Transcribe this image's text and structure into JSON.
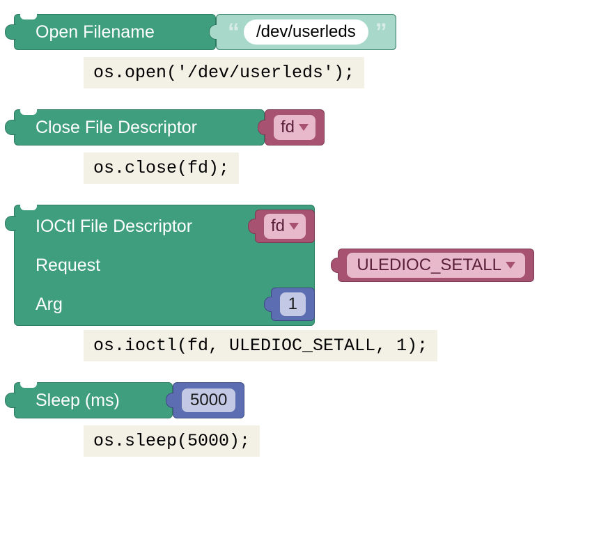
{
  "blocks": {
    "open": {
      "label": "Open Filename",
      "value": "/dev/userleds",
      "code": "os.open('/dev/userleds');"
    },
    "close": {
      "label": "Close File Descriptor",
      "var": "fd",
      "code": "os.close(fd);"
    },
    "ioctl": {
      "label": "IOCtl File Descriptor",
      "var": "fd",
      "request_label": "Request",
      "request_value": "ULEDIOC_SETALL",
      "arg_label": "Arg",
      "arg_value": "1",
      "code": "os.ioctl(fd, ULEDIOC_SETALL, 1);"
    },
    "sleep": {
      "label": "Sleep (ms)",
      "value": "5000",
      "code": "os.sleep(5000);"
    }
  }
}
